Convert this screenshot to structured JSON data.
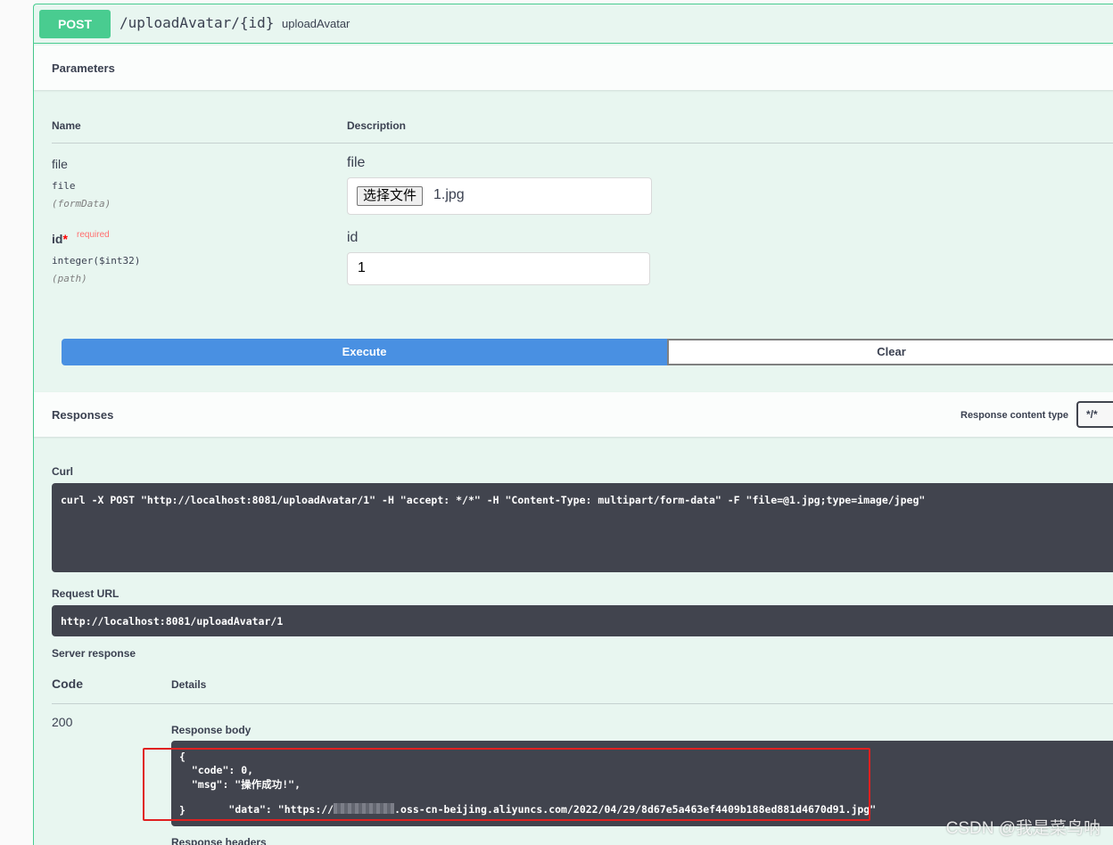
{
  "operation": {
    "method": "POST",
    "path": "/uploadAvatar/{id}",
    "operation_id": "uploadAvatar"
  },
  "parameters": {
    "title": "Parameters",
    "col_name": "Name",
    "col_description": "Description",
    "items": [
      {
        "name": "file",
        "required": false,
        "type": "file",
        "in": "(formData)",
        "description": "file",
        "file_button": "选择文件",
        "value": "1.jpg"
      },
      {
        "name": "id",
        "required": true,
        "required_label": "required",
        "type": "integer($int32)",
        "in": "(path)",
        "description": "id",
        "value": "1"
      }
    ]
  },
  "actions": {
    "execute_label": "Execute",
    "clear_label": "Clear"
  },
  "responses": {
    "title": "Responses",
    "content_type_label": "Response content type",
    "content_type_value": "*/*",
    "curl_label": "Curl",
    "curl": "curl -X POST \"http://localhost:8081/uploadAvatar/1\" -H \"accept: */*\" -H \"Content-Type: multipart/form-data\" -F \"file=@1.jpg;type=image/jpeg\"",
    "request_url_label": "Request URL",
    "request_url": "http://localhost:8081/uploadAvatar/1",
    "server_response_label": "Server response",
    "code_header": "Code",
    "details_header": "Details",
    "status_code": "200",
    "response_body_label": "Response body",
    "response_body_lines": [
      "{",
      "  \"code\": 0,",
      "  \"msg\": \"操作成功!\",",
      "  \"data\": \"https://",
      "}"
    ],
    "response_data_url_tail": ".oss-cn-beijing.aliyuncs.com/2022/04/29/8d67e5a463ef4409b188ed881d4670d91.jpg\"",
    "response_headers_label": "Response headers"
  },
  "watermark": "CSDN @我是菜鸟呐",
  "colors": {
    "post": "#49cc90",
    "execute": "#4990e2",
    "code_bg": "#41444e",
    "highlight_box": "#e02020"
  }
}
